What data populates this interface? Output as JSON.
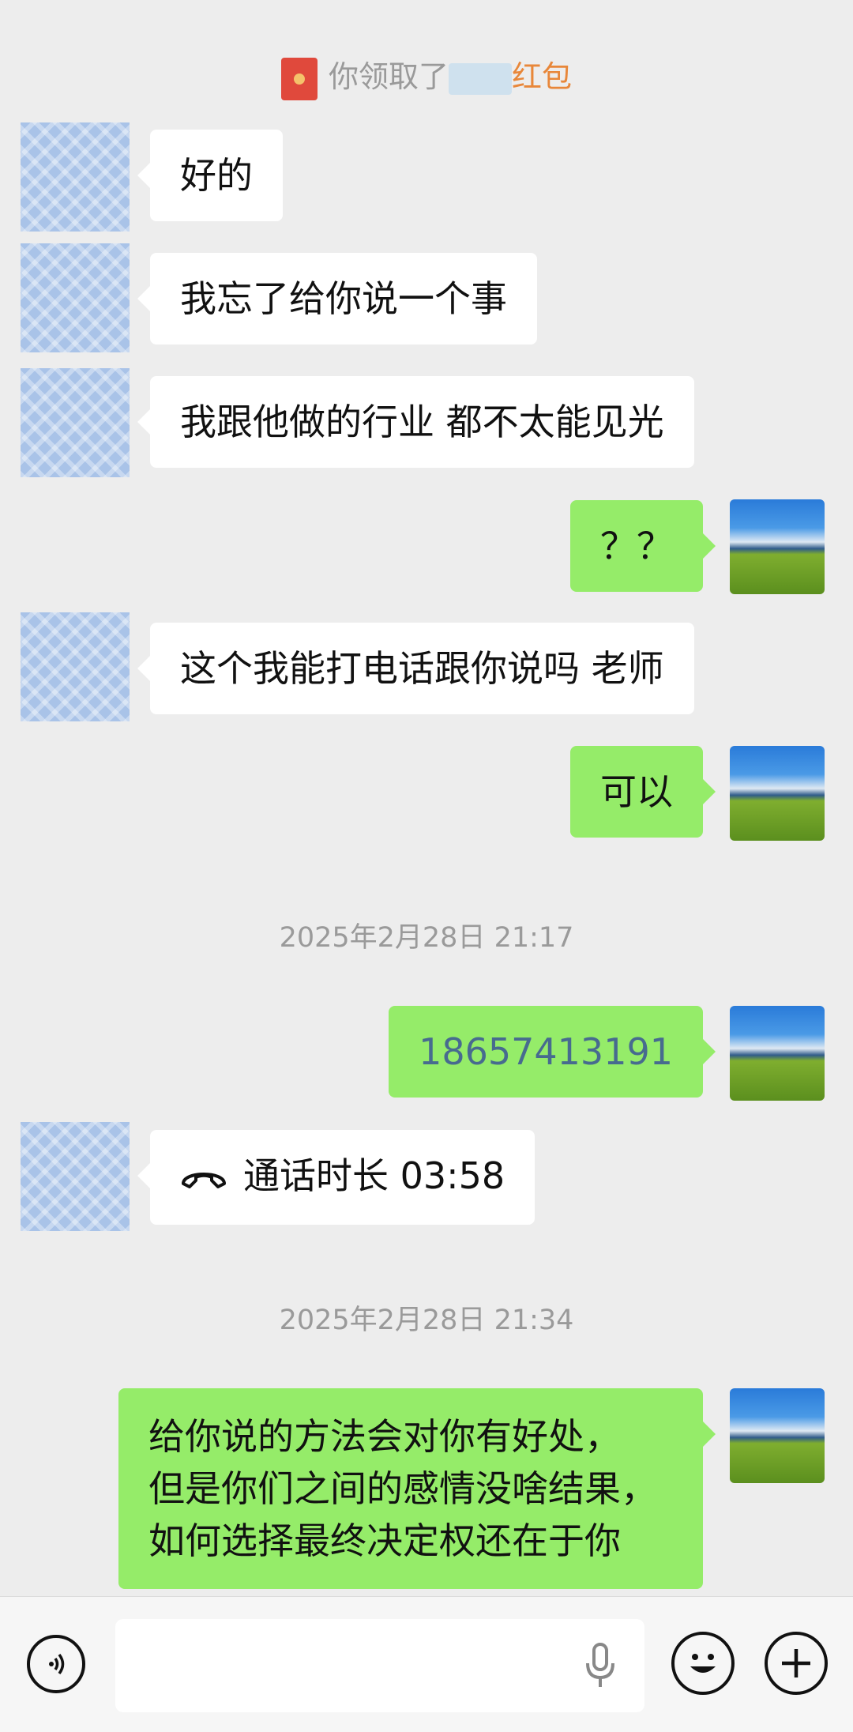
{
  "system_notice": {
    "prefix": "你领取了",
    "suffix": "红包"
  },
  "messages": [
    {
      "side": "left",
      "text": "好的"
    },
    {
      "side": "left",
      "text": "我忘了给你说一个事"
    },
    {
      "side": "left",
      "text": "我跟他做的行业 都不太能见光"
    },
    {
      "side": "right",
      "text": "？？"
    },
    {
      "side": "left",
      "text": "这个我能打电话跟你说吗 老师"
    },
    {
      "side": "right",
      "text": "可以"
    },
    {
      "side": "right",
      "text": "18657413191"
    },
    {
      "side": "left",
      "text": "通话时长 03:58"
    },
    {
      "side": "right",
      "lines": [
        "给你说的方法会对你有好处，",
        "但是你们之间的感情没啥结果，",
        "如何选择最终决定权还在于你"
      ]
    }
  ],
  "timestamps": [
    "2025年2月28日 21:17",
    "2025年2月28日 21:34"
  ],
  "toolbar": {
    "voice_icon": "voice-mode-icon",
    "mic_icon": "microphone-icon",
    "emoji_icon": "emoji-icon",
    "plus_icon": "plus-icon"
  },
  "colors": {
    "self_bubble": "#95ec69",
    "other_bubble": "#ffffff",
    "background": "#ededed",
    "link": "#476b8f"
  }
}
